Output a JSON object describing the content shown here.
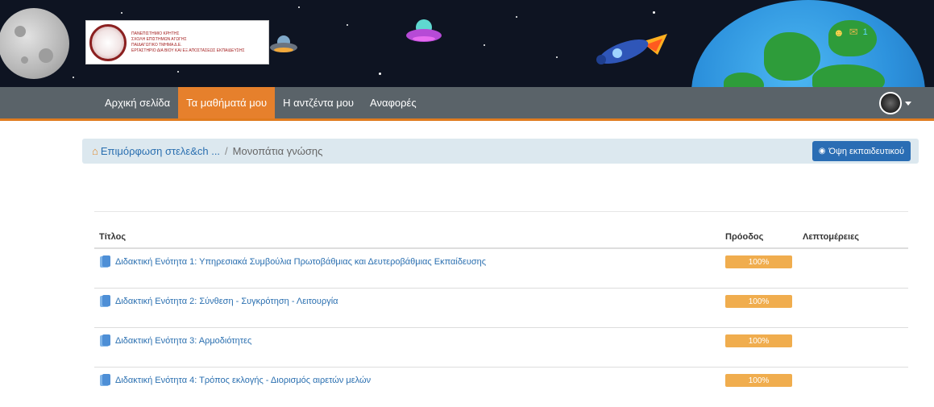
{
  "banner": {
    "logo_lines": [
      "ΠΑΝΕΠΙΣΤΗΜΙΟ ΚΡΗΤΗΣ",
      "ΣΧΟΛΗ ΕΠΙΣΤΗΜΩΝ ΑΓΩΓΗΣ",
      "ΠΑΙΔΑΓΩΓΙΚΟ ΤΜΗΜΑ Δ.Ε.",
      "ΕΡΓΑΣΤΗΡΙΟ ΔΙΑ ΒΙΟΥ ΚΑΙ ΕΞ ΑΠΟΣΤΑΣΕΩΣ ΕΚΠΑΙΔΕΥΣΗΣ"
    ],
    "notifications_count": "1"
  },
  "nav": {
    "items": [
      {
        "label": "Αρχική σελίδα",
        "active": false
      },
      {
        "label": "Τα μαθήματά μου",
        "active": true
      },
      {
        "label": "Η αντζέντα μου",
        "active": false
      },
      {
        "label": "Αναφορές",
        "active": false
      }
    ]
  },
  "breadcrumb": {
    "course": "Επιμόρφωση στελε&ch ...",
    "separator": "/",
    "current": "Μονοπάτια γνώσης",
    "teacher_view_label": "Όψη εκπαιδευτικού"
  },
  "table": {
    "headers": {
      "title": "Τίτλος",
      "progress": "Πρόοδος",
      "details": "Λεπτομέρειες"
    },
    "rows": [
      {
        "title": "Διδακτική Ενότητα 1: Υπηρεσιακά Συμβούλια Πρωτοβάθμιας και Δευτεροβάθμιας Εκπαίδευσης",
        "progress": "100%"
      },
      {
        "title": "Διδακτική Ενότητα 2: Σύνθεση - Συγκρότηση - Λειτουργία",
        "progress": "100%"
      },
      {
        "title": "Διδακτική Ενότητα 3: Αρμοδιότητες",
        "progress": "100%"
      },
      {
        "title": "Διδακτική Ενότητα 4: Τρόπος εκλογής - Διορισμός αιρετών μελών",
        "progress": "100%"
      }
    ]
  },
  "colors": {
    "accent": "#e6802c",
    "nav_bg": "#5a6369",
    "progress": "#f0ad4e",
    "link": "#2a6fb0"
  }
}
